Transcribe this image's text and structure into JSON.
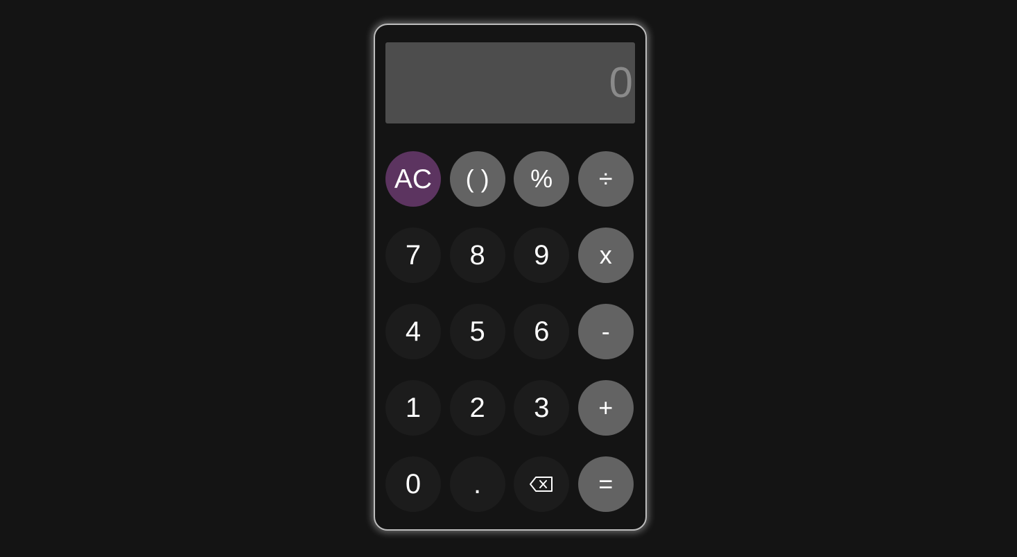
{
  "display": {
    "value": "0"
  },
  "colors": {
    "page_background": "#141414",
    "display_background": "#4d4d4d",
    "display_text": "#8a8a8a",
    "digit_key": "#1c1c1c",
    "operator_key": "#636363",
    "clear_key": "#5c3460"
  },
  "keys": {
    "clear": "AC",
    "parens": "( )",
    "percent": "%",
    "divide": "÷",
    "seven": "7",
    "eight": "8",
    "nine": "9",
    "multiply": "x",
    "four": "4",
    "five": "5",
    "six": "6",
    "subtract": "-",
    "one": "1",
    "two": "2",
    "three": "3",
    "add": "+",
    "zero": "0",
    "decimal": ".",
    "backspace_icon": "backspace-icon",
    "equals": "="
  }
}
